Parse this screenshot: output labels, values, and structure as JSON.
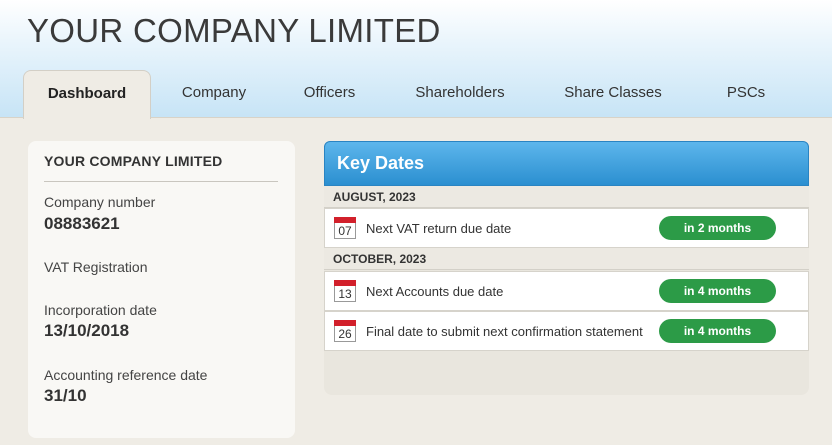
{
  "header": {
    "company_name": "YOUR COMPANY LIMITED"
  },
  "tabs": [
    {
      "label": "Dashboard",
      "active": true
    },
    {
      "label": "Company",
      "active": false
    },
    {
      "label": "Officers",
      "active": false
    },
    {
      "label": "Shareholders",
      "active": false
    },
    {
      "label": "Share Classes",
      "active": false
    },
    {
      "label": "PSCs",
      "active": false
    }
  ],
  "company_card": {
    "title": "YOUR COMPANY LIMITED",
    "fields": [
      {
        "label": "Company number",
        "value": "08883621"
      },
      {
        "label": "VAT Registration",
        "value": ""
      },
      {
        "label": "Incorporation date",
        "value": "13/10/2018"
      },
      {
        "label": "Accounting reference date",
        "value": "31/10"
      }
    ]
  },
  "key_dates": {
    "title": "Key Dates",
    "groups": [
      {
        "month": "AUGUST, 2023",
        "events": [
          {
            "day": "07",
            "label": "Next VAT return due date",
            "due": "in 2 months"
          }
        ]
      },
      {
        "month": "OCTOBER, 2023",
        "events": [
          {
            "day": "13",
            "label": "Next Accounts due date",
            "due": "in 4 months"
          },
          {
            "day": "26",
            "label": "Final date to submit next confirmation statement",
            "due": "in 4 months"
          }
        ]
      }
    ]
  },
  "colors": {
    "accent_blue": "#2b8fd0",
    "badge_green": "#2c9b47",
    "calendar_red": "#d2202b"
  }
}
